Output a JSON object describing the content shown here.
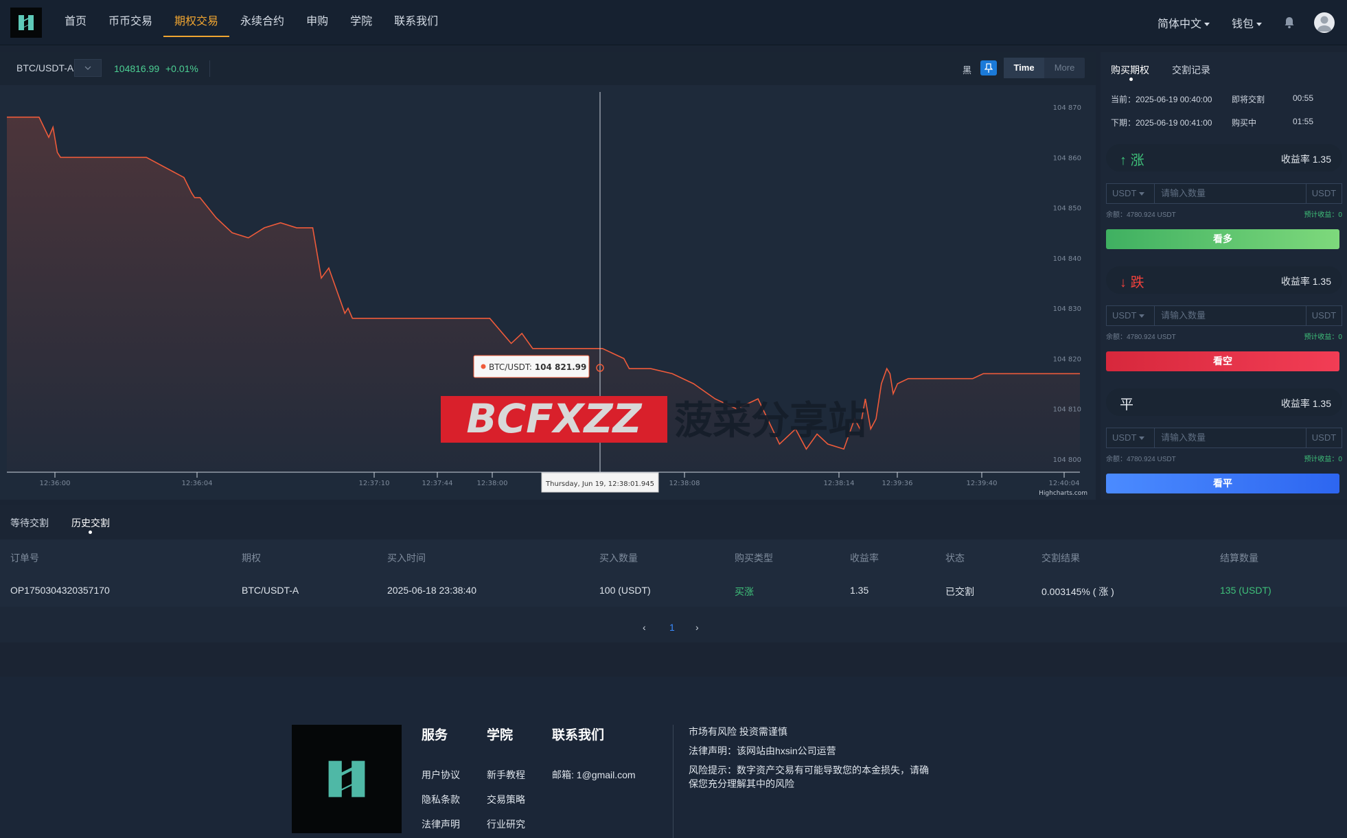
{
  "header": {
    "nav": [
      "首页",
      "币币交易",
      "期权交易",
      "永续合约",
      "申购",
      "学院",
      "联系我们"
    ],
    "active_nav": 2,
    "language": "简体中文",
    "wallet": "钱包"
  },
  "chart_toolbar": {
    "pair": "BTC/USDT-A",
    "price": "104816.99",
    "change": "+0.01%",
    "theme_label": "黑",
    "timeframes": [
      "Time",
      "More"
    ]
  },
  "chart_data": {
    "type": "line",
    "series": [
      {
        "name": "BTC/USDT",
        "x": [
          0,
          0.03,
          0.039,
          0.043,
          0.047,
          0.05,
          0.055,
          0.13,
          0.165,
          0.172,
          0.175,
          0.18,
          0.195,
          0.21,
          0.225,
          0.24,
          0.255,
          0.27,
          0.285,
          0.293,
          0.3,
          0.31,
          0.315,
          0.318,
          0.322,
          0.33,
          0.337,
          0.345,
          0.36,
          0.45,
          0.47,
          0.48,
          0.49,
          0.5,
          0.555,
          0.575,
          0.58,
          0.6,
          0.62,
          0.64,
          0.66,
          0.68,
          0.7,
          0.72,
          0.735,
          0.745,
          0.755,
          0.765,
          0.78,
          0.79,
          0.795,
          0.8,
          0.805,
          0.81,
          0.815,
          0.82,
          0.823,
          0.826,
          0.83,
          0.84,
          0.845,
          0.9,
          0.91,
          1
        ],
        "y": [
          104868,
          104868,
          104864,
          104866,
          104861,
          104860,
          104860,
          104860,
          104856,
          104853,
          104852,
          104852,
          104848,
          104845,
          104844,
          104846,
          104847,
          104846,
          104846,
          104836,
          104838,
          104832,
          104829,
          104830,
          104828,
          104828,
          104828,
          104828,
          104828,
          104828,
          104823,
          104825,
          104822,
          104822,
          104822,
          104820,
          104818,
          104818,
          104817,
          104815,
          104812,
          104810,
          104812,
          104803,
          104806,
          104802,
          104805,
          104803,
          104802,
          104808,
          104806,
          104812,
          104806,
          104808,
          104815,
          104818,
          104817,
          104813,
          104815,
          104816,
          104816,
          104816,
          104817,
          104817
        ]
      }
    ],
    "ylim": [
      104800,
      104870
    ],
    "y_ticks": [
      "104 870",
      "104 860",
      "104 850",
      "104 840",
      "104 830",
      "104 820",
      "104 810",
      "104 800"
    ],
    "x_ticks": [
      "12:36:00",
      "12:36:04",
      "12:37:10",
      "12:37:44",
      "12:38:00",
      "",
      "12:38:08",
      "12:38:14",
      "12:39:36",
      "12:39:40",
      "12:40:04"
    ],
    "tooltip_label": "BTC/USDT: ",
    "tooltip_value": "104 821.99",
    "crosshair_label": "Thursday, Jun 19, 12:38:01.945",
    "credits": "Highcharts.com",
    "color": "#ef5b3a",
    "grid": false
  },
  "right_panel": {
    "tabs": [
      "购买期权",
      "交割记录"
    ],
    "current_label": "当前：2025-06-19 00:40:00",
    "current_status": "即将交割",
    "current_time": "00:55",
    "next_label": "下期：2025-06-19 00:41:00",
    "next_status": "购买中",
    "next_time": "01:55",
    "sections": [
      {
        "arrow": "↑",
        "title": "涨",
        "rate": "收益率 1.35",
        "currency": "USDT",
        "placeholder": "请输入数量",
        "unit": "USDT",
        "balance": "余额：4780.924 USDT",
        "estimate": "预计收益：0",
        "button": "看多",
        "color": "#3fc27a"
      },
      {
        "arrow": "↓",
        "title": "跌",
        "rate": "收益率 1.35",
        "currency": "USDT",
        "placeholder": "请输入数量",
        "unit": "USDT",
        "balance": "余额：4780.924 USDT",
        "estimate": "预计收益：0",
        "button": "看空",
        "color": "#f0413c"
      },
      {
        "arrow": "",
        "title": "平",
        "rate": "收益率 1.35",
        "currency": "USDT",
        "placeholder": "请输入数量",
        "unit": "USDT",
        "balance": "余额：4780.924 USDT",
        "estimate": "预计收益：0",
        "button": "看平",
        "color": "#e3e8ee"
      }
    ]
  },
  "orders": {
    "tabs": [
      "等待交割",
      "历史交割"
    ],
    "columns": [
      "订单号",
      "期权",
      "买入时间",
      "买入数量",
      "购买类型",
      "收益率",
      "状态",
      "交割结果",
      "结算数量"
    ],
    "rows": [
      [
        "OP1750304320357170",
        "BTC/USDT-A",
        "2025-06-18 23:38:40",
        "100 (USDT)",
        "买涨",
        "1.35",
        "已交割",
        "0.003145% ( 涨 )",
        "135 (USDT)"
      ]
    ],
    "page": "1"
  },
  "watermark": {
    "latin": "BCFXZZ",
    "cn": "菠菜分享站"
  },
  "footer": {
    "headings": [
      "服务",
      "学院",
      "联系我们"
    ],
    "service_links": [
      "用户协议",
      "隐私条款",
      "法律声明"
    ],
    "academy_links": [
      "新手教程",
      "交易策略",
      "行业研究"
    ],
    "email": "邮箱: 1@gmail.com",
    "notices": [
      "市场有风险 投资需谨慎",
      "法律声明：该网站由hxsin公司运营",
      "风险提示：数字资产交易有可能导致您的本金损失，请确保您充分理解其中的风险"
    ]
  }
}
